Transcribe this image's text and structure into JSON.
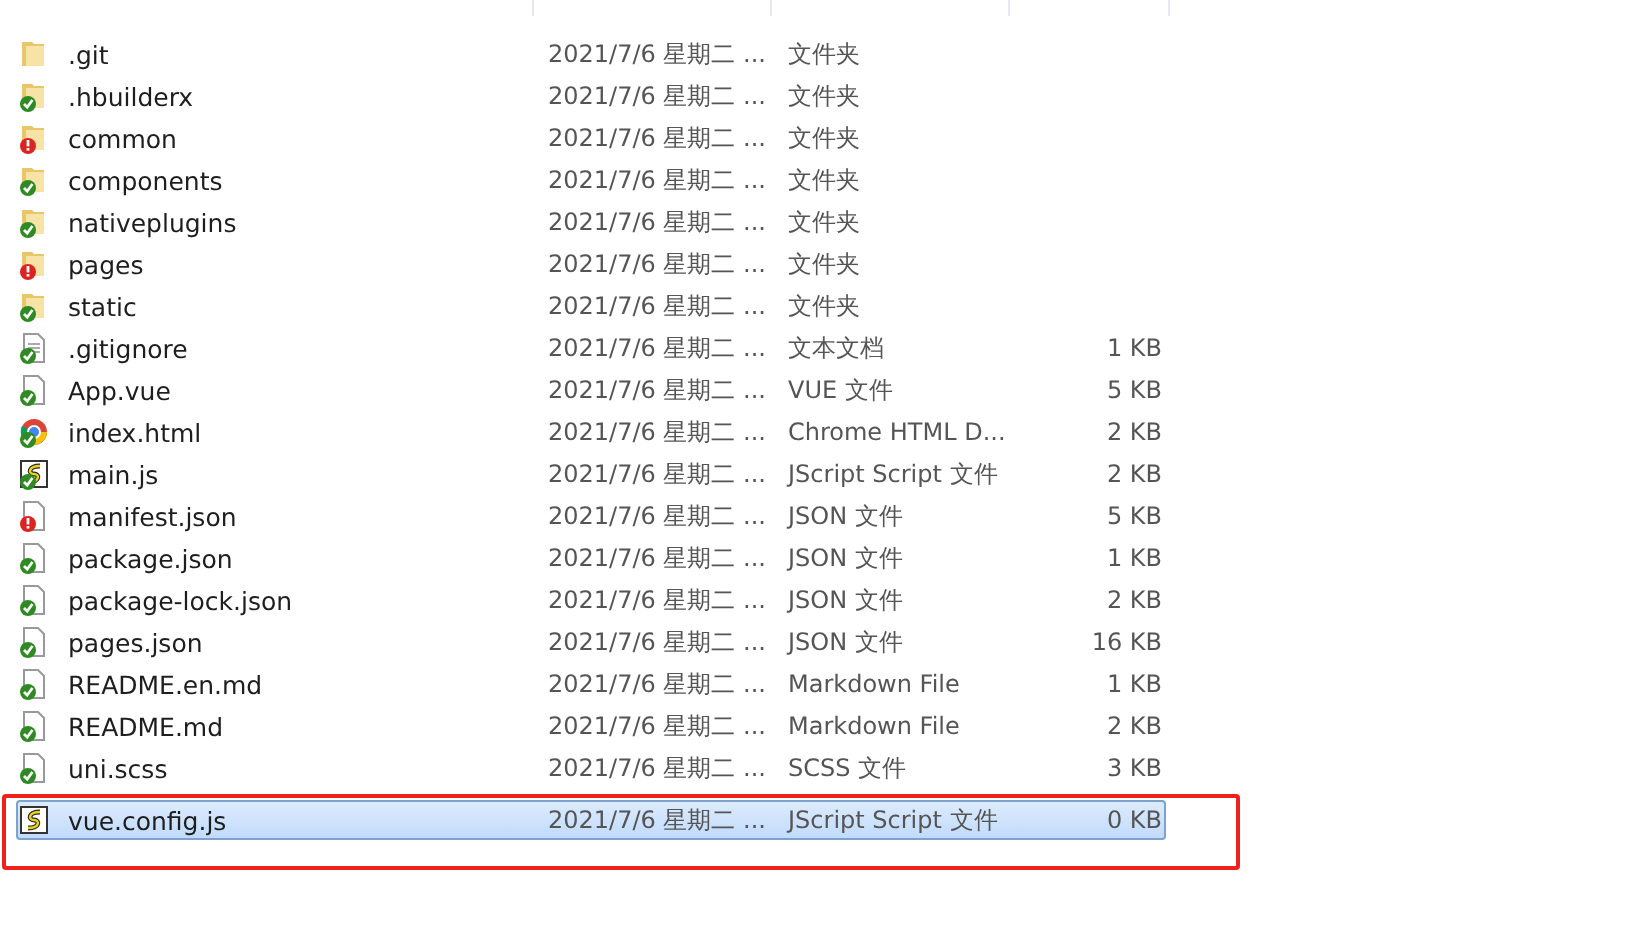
{
  "files": [
    {
      "name": ".git",
      "date": "2021/7/6 星期二 ...",
      "type": "文件夹",
      "kind": "folder",
      "synced": false,
      "modified": false,
      "selected": false,
      "annotated": false
    },
    {
      "name": ".hbuilderx",
      "date": "2021/7/6 星期二 ...",
      "type": "文件夹",
      "kind": "folder",
      "synced": true,
      "modified": false,
      "selected": false,
      "annotated": false
    },
    {
      "name": "common",
      "date": "2021/7/6 星期二 ...",
      "type": "文件夹",
      "kind": "folder",
      "synced": false,
      "modified": true,
      "selected": false,
      "annotated": false
    },
    {
      "name": "components",
      "date": "2021/7/6 星期二 ...",
      "type": "文件夹",
      "kind": "folder",
      "synced": true,
      "modified": false,
      "selected": false,
      "annotated": false
    },
    {
      "name": "nativeplugins",
      "date": "2021/7/6 星期二 ...",
      "type": "文件夹",
      "kind": "folder",
      "synced": true,
      "modified": false,
      "selected": false,
      "annotated": false
    },
    {
      "name": "pages",
      "date": "2021/7/6 星期二 ...",
      "type": "文件夹",
      "kind": "folder",
      "synced": false,
      "modified": true,
      "selected": false,
      "annotated": false
    },
    {
      "name": "static",
      "date": "2021/7/6 星期二 ...",
      "type": "文件夹",
      "kind": "folder",
      "synced": true,
      "modified": false,
      "selected": false,
      "annotated": false
    },
    {
      "name": ".gitignore",
      "date": "2021/7/6 星期二 ...",
      "type": "文本文档",
      "size": "1 KB",
      "kind": "text",
      "synced": true,
      "modified": false,
      "selected": false,
      "annotated": false
    },
    {
      "name": "App.vue",
      "date": "2021/7/6 星期二 ...",
      "type": "VUE 文件",
      "size": "5 KB",
      "kind": "file",
      "synced": true,
      "modified": false,
      "selected": false,
      "annotated": false
    },
    {
      "name": "index.html",
      "date": "2021/7/6 星期二 ...",
      "type": "Chrome HTML D...",
      "size": "2 KB",
      "kind": "browser",
      "synced": true,
      "modified": false,
      "selected": false,
      "annotated": false
    },
    {
      "name": "main.js",
      "date": "2021/7/6 星期二 ...",
      "type": "JScript Script 文件",
      "size": "2 KB",
      "kind": "script",
      "synced": true,
      "modified": false,
      "selected": false,
      "annotated": false
    },
    {
      "name": "manifest.json",
      "date": "2021/7/6 星期二 ...",
      "type": "JSON 文件",
      "size": "5 KB",
      "kind": "file",
      "synced": false,
      "modified": true,
      "selected": false,
      "annotated": false
    },
    {
      "name": "package.json",
      "date": "2021/7/6 星期二 ...",
      "type": "JSON 文件",
      "size": "1 KB",
      "kind": "file",
      "synced": true,
      "modified": false,
      "selected": false,
      "annotated": false
    },
    {
      "name": "package-lock.json",
      "date": "2021/7/6 星期二 ...",
      "type": "JSON 文件",
      "size": "2 KB",
      "kind": "file",
      "synced": true,
      "modified": false,
      "selected": false,
      "annotated": false
    },
    {
      "name": "pages.json",
      "date": "2021/7/6 星期二 ...",
      "type": "JSON 文件",
      "size": "16 KB",
      "kind": "file",
      "synced": true,
      "modified": false,
      "selected": false,
      "annotated": false
    },
    {
      "name": "README.en.md",
      "date": "2021/7/6 星期二 ...",
      "type": "Markdown File",
      "size": "1 KB",
      "kind": "file",
      "synced": true,
      "modified": false,
      "selected": false,
      "annotated": false
    },
    {
      "name": "README.md",
      "date": "2021/7/6 星期二 ...",
      "type": "Markdown File",
      "size": "2 KB",
      "kind": "file",
      "synced": true,
      "modified": false,
      "selected": false,
      "annotated": false
    },
    {
      "name": "uni.scss",
      "date": "2021/7/6 星期二 ...",
      "type": "SCSS 文件",
      "size": "3 KB",
      "kind": "file",
      "synced": true,
      "modified": false,
      "selected": false,
      "annotated": false
    },
    {
      "name": "vue.config.js",
      "date": "2021/7/6 星期二 ...",
      "type": "JScript Script 文件",
      "size": "0 KB",
      "kind": "script",
      "synced": false,
      "modified": false,
      "selected": true,
      "annotated": true
    }
  ]
}
